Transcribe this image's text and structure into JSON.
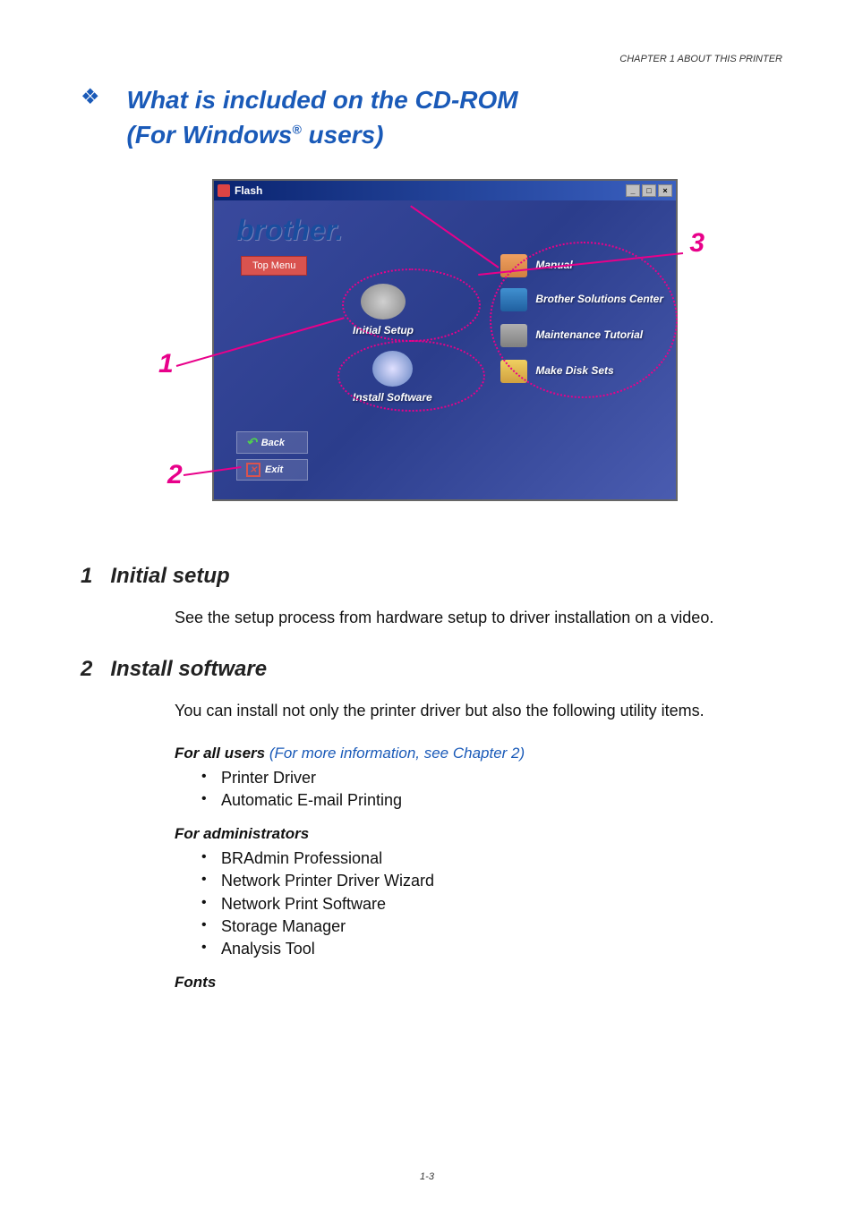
{
  "header": {
    "chapter_text": "CHAPTER 1 ABOUT THIS PRINTER"
  },
  "main_title": {
    "line1": "What is included on the CD-ROM",
    "line2_pre": "(For Windows",
    "line2_sup": "®",
    "line2_post": " users)"
  },
  "screenshot": {
    "titlebar": "Flash",
    "logo": "brother.",
    "top_menu": "Top Menu",
    "options": {
      "initial_setup": "Initial Setup",
      "install_software": "Install Software",
      "manual": "Manual",
      "brother_solutions": "Brother Solutions Center",
      "maintenance": "Maintenance Tutorial",
      "make_disk": "Make Disk Sets"
    },
    "nav": {
      "back": "Back",
      "exit": "Exit"
    },
    "window_controls": {
      "minimize": "_",
      "maximize": "□",
      "close": "×"
    }
  },
  "callouts": {
    "c1": "1",
    "c2": "2",
    "c3": "3"
  },
  "sections": {
    "s1": {
      "num": "1",
      "title": "Initial setup",
      "body": "See the setup process from hardware setup to driver installation on a video."
    },
    "s2": {
      "num": "2",
      "title": "Install software",
      "body": "You can install not only the printer driver but also the following utility items.",
      "for_all_users": {
        "label": "For all users",
        "link_pre": " (",
        "link": "For more information, see Chapter 2",
        "link_post": ")",
        "items": [
          "Printer Driver",
          "Automatic E-mail Printing"
        ]
      },
      "for_admins": {
        "label": "For administrators",
        "items": [
          "BRAdmin Professional",
          "Network Printer Driver Wizard",
          "Network Print Software",
          "Storage Manager",
          "Analysis Tool"
        ]
      },
      "fonts": {
        "label": "Fonts"
      }
    }
  },
  "footer": {
    "page": "1-3"
  }
}
